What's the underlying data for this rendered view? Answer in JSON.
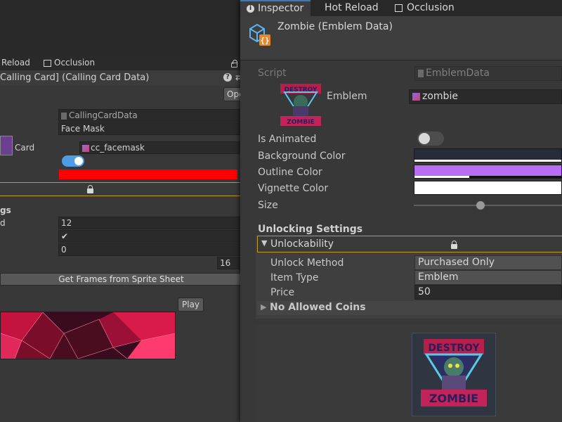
{
  "back_window": {
    "tabs": [
      "Reload",
      "Occlusion"
    ],
    "title": "Calling Card] (Calling Card Data)",
    "open_button": "Ope",
    "script_value": "CallingCardData",
    "name_value": "Face Mask",
    "card_label": "Card",
    "card_value": "cc_facemask",
    "accent_color": "#ff0000",
    "section_label": "gs",
    "row_label": "d",
    "value_row1": "12",
    "value_row2": "✔",
    "value_row3": "0",
    "value_row4": "16",
    "frames_button": "Get Frames from Sprite Sheet",
    "play_button": "Play"
  },
  "inspector": {
    "tabs": {
      "inspector": "Inspector",
      "hot_reload": "Hot Reload",
      "occlusion": "Occlusion"
    },
    "object_title": "Zombie (Emblem Data)",
    "script_label": "Script",
    "script_value": "EmblemData",
    "emblem_label": "Emblem",
    "emblem_value": "zombie",
    "is_animated_label": "Is Animated",
    "is_animated": false,
    "background_color_label": "Background Color",
    "background_color": "#272c38",
    "outline_color_label": "Outline Color",
    "outline_color": "#b86ef2",
    "vignette_color_label": "Vignette Color",
    "vignette_color": "#ffffff",
    "size_label": "Size",
    "size_value": 0.45,
    "unlocking_settings_label": "Unlocking Settings",
    "unlockability_label": "Unlockability",
    "unlock_method_label": "Unlock Method",
    "unlock_method_value": "Purchased Only",
    "item_type_label": "Item Type",
    "item_type_value": "Emblem",
    "price_label": "Price",
    "price_value": "50",
    "no_allowed_coins_label": "No Allowed Coins",
    "preview_art_text_top": "DESTROY",
    "preview_art_text_bottom": "ZOMBIE"
  }
}
